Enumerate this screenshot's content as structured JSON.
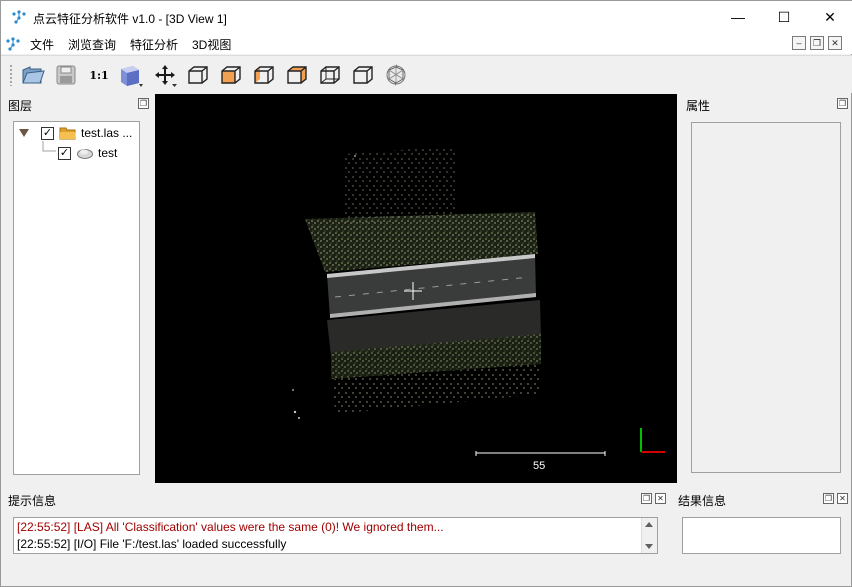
{
  "window": {
    "title": "点云特征分析软件 v1.0 - [3D View 1]",
    "controls": {
      "minimize": "—",
      "maximize": "☐",
      "close": "✕"
    }
  },
  "menu": {
    "items": [
      "文件",
      "浏览查询",
      "特征分析",
      "3D视图"
    ]
  },
  "toolbar": {
    "buttons": [
      {
        "name": "open",
        "icon": "folder-open-icon"
      },
      {
        "name": "save",
        "icon": "save-icon"
      },
      {
        "name": "zoom-1-1",
        "label": "1:1"
      },
      {
        "name": "view-mode",
        "icon": "cube-shaded-icon"
      },
      {
        "name": "pan",
        "icon": "move-cross-icon"
      },
      {
        "name": "view-front",
        "icon": "cube-view-icon"
      },
      {
        "name": "view-back",
        "icon": "cube-view-icon"
      },
      {
        "name": "view-left",
        "icon": "cube-view-icon"
      },
      {
        "name": "view-right",
        "icon": "cube-view-icon"
      },
      {
        "name": "view-top",
        "icon": "cube-view-icon"
      },
      {
        "name": "view-bottom",
        "icon": "cube-view-icon"
      },
      {
        "name": "rotate",
        "icon": "rotate-icon"
      }
    ],
    "zoom_label": "1:1"
  },
  "layers": {
    "title": "图层",
    "items": [
      {
        "label": "test.las ...",
        "checked": true,
        "icon": "folder-icon"
      },
      {
        "label": "test",
        "checked": true,
        "icon": "cloud-icon"
      }
    ]
  },
  "properties": {
    "title": "属性"
  },
  "view3d": {
    "scale_value": "55",
    "background": "#000000"
  },
  "console": {
    "title": "提示信息",
    "lines": [
      {
        "text": "[22:55:52] [LAS] All 'Classification' values were the same (0)! We ignored them...",
        "level": "warning"
      },
      {
        "text": "[22:55:52] [I/O] File 'F:/test.las' loaded successfully",
        "level": "info"
      }
    ]
  },
  "results": {
    "title": "结果信息"
  },
  "colors": {
    "warning_text": "#a00000",
    "panel_bg": "#f0f0f0",
    "view_bg": "#000000",
    "cube_orange": "#f0a050"
  }
}
